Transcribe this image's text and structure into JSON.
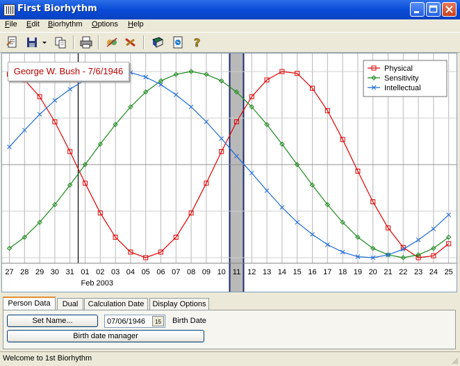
{
  "window": {
    "title": "First Biorhythm"
  },
  "menu": [
    "File",
    "Edit",
    "Biorhythm",
    "Options",
    "Help"
  ],
  "toolbar_icons": [
    "new-document-icon",
    "save-icon",
    "dropdown-arrow-icon",
    "copy-icon",
    "print-icon",
    "compatibility-icon",
    "tools-icon",
    "book-icon",
    "notebook-icon",
    "help-icon"
  ],
  "person_label": "George W. Bush - 7/6/1946",
  "chart_data": {
    "type": "line",
    "title": "",
    "x": [
      "27",
      "28",
      "29",
      "30",
      "31",
      "01",
      "02",
      "03",
      "04",
      "05",
      "06",
      "07",
      "08",
      "09",
      "10",
      "11",
      "12",
      "13",
      "14",
      "15",
      "16",
      "17",
      "18",
      "19",
      "20",
      "21",
      "22",
      "23",
      "24",
      "25"
    ],
    "month_label": "Feb 2003",
    "highlighted_day": "11",
    "today_day": "01",
    "ylim": [
      -100,
      100
    ],
    "series": [
      {
        "name": "Physical",
        "period": 23,
        "color": "#e00000",
        "marker": "square",
        "values": [
          97,
          91,
          73,
          46,
          14,
          -20,
          -52,
          -78,
          -94,
          -100,
          -94,
          -78,
          -52,
          -20,
          14,
          46,
          73,
          91,
          100,
          98,
          82,
          58,
          27,
          -7,
          -40,
          -68,
          -89,
          -100,
          -98,
          -85
        ]
      },
      {
        "name": "Sensitivity",
        "period": 28,
        "color": "#1a8a1a",
        "marker": "diamond",
        "values": [
          -90,
          -78,
          -62,
          -43,
          -22,
          0,
          22,
          43,
          62,
          78,
          90,
          97,
          100,
          97,
          90,
          78,
          62,
          43,
          22,
          0,
          -22,
          -43,
          -62,
          -78,
          -90,
          -97,
          -100,
          -97,
          -90,
          -78
        ]
      },
      {
        "name": "Intellectual",
        "period": 33,
        "color": "#1e6ad8",
        "marker": "x",
        "values": [
          19,
          37,
          54,
          69,
          81,
          91,
          97,
          100,
          99,
          94,
          86,
          75,
          62,
          46,
          28,
          9,
          -9,
          -28,
          -46,
          -62,
          -75,
          -86,
          -94,
          -99,
          -100,
          -97,
          -91,
          -81,
          -69,
          -54
        ]
      }
    ],
    "legend_position": "top-right",
    "grid": true
  },
  "tabs": [
    "Person Data",
    "Dual",
    "Calculation Date",
    "Display Options"
  ],
  "form": {
    "set_name_label": "Set Name...",
    "birth_date_value": "07/06/1946",
    "calendar_icon_text": "15",
    "birth_date_label": "Birth Date",
    "manager_label": "Birth date manager"
  },
  "status_text": "Welcome to 1st Biorhythm"
}
